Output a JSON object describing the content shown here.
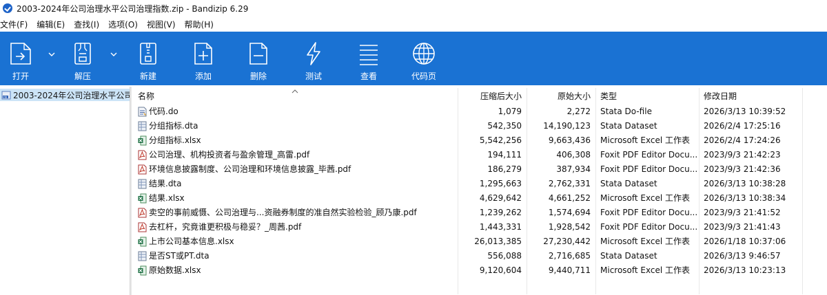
{
  "window": {
    "title": "2003-2024年公司治理水平公司治理指数.zip - Bandizip 6.29"
  },
  "menu": [
    "文件(F)",
    "编辑(E)",
    "查找(I)",
    "选项(O)",
    "视图(V)",
    "帮助(H)"
  ],
  "toolbar": {
    "open": "打开",
    "extract": "解压",
    "new": "新建",
    "add": "添加",
    "delete": "删除",
    "test": "测试",
    "view": "查看",
    "codepage": "代码页"
  },
  "tree": {
    "root": "2003-2024年公司治理水平公司"
  },
  "columns": {
    "name": "名称",
    "compressed": "压缩后大小",
    "original": "原始大小",
    "type": "类型",
    "modified": "修改日期"
  },
  "files": [
    {
      "name": "代码.do",
      "compressed": "1,079",
      "original": "2,272",
      "type": "Stata Do-file",
      "modified": "2026/3/13 10:39:52",
      "icon": "stata-do-icon"
    },
    {
      "name": "分组指标.dta",
      "compressed": "542,350",
      "original": "14,190,123",
      "type": "Stata Dataset",
      "modified": "2026/2/4 17:25:16",
      "icon": "stata-dta-icon"
    },
    {
      "name": "分组指标.xlsx",
      "compressed": "5,542,256",
      "original": "9,663,436",
      "type": "Microsoft Excel 工作表",
      "modified": "2026/2/4 17:24:26",
      "icon": "excel-icon"
    },
    {
      "name": "公司治理、机构投资者与盈余管理_高雷.pdf",
      "compressed": "194,111",
      "original": "406,308",
      "type": "Foxit PDF Editor Docu...",
      "modified": "2023/9/3 21:42:23",
      "icon": "pdf-icon"
    },
    {
      "name": "环境信息披露制度、公司治理和环境信息披露_毕茜.pdf",
      "compressed": "186,279",
      "original": "387,934",
      "type": "Foxit PDF Editor Docu...",
      "modified": "2023/9/3 21:42:36",
      "icon": "pdf-icon"
    },
    {
      "name": "结果.dta",
      "compressed": "1,295,663",
      "original": "2,762,331",
      "type": "Stata Dataset",
      "modified": "2026/3/13 10:38:28",
      "icon": "stata-dta-icon"
    },
    {
      "name": "结果.xlsx",
      "compressed": "4,629,642",
      "original": "4,661,252",
      "type": "Microsoft Excel 工作表",
      "modified": "2026/3/13 10:38:34",
      "icon": "excel-icon"
    },
    {
      "name": "卖空的事前威慑、公司治理与...资融券制度的准自然实验检验_顾乃康.pdf",
      "compressed": "1,239,262",
      "original": "1,574,694",
      "type": "Foxit PDF Editor Docu...",
      "modified": "2023/9/3 21:41:52",
      "icon": "pdf-icon"
    },
    {
      "name": "去杠杆，究竟谁更积极与稳妥？_周茜.pdf",
      "compressed": "1,443,331",
      "original": "1,928,542",
      "type": "Foxit PDF Editor Docu...",
      "modified": "2023/9/3 21:41:43",
      "icon": "pdf-icon"
    },
    {
      "name": "上市公司基本信息.xlsx",
      "compressed": "26,013,385",
      "original": "27,230,442",
      "type": "Microsoft Excel 工作表",
      "modified": "2026/1/18 10:37:06",
      "icon": "excel-icon"
    },
    {
      "name": "是否ST或PT.dta",
      "compressed": "556,088",
      "original": "2,716,685",
      "type": "Stata Dataset",
      "modified": "2026/3/13 9:46:57",
      "icon": "stata-dta-icon"
    },
    {
      "name": "原始数据.xlsx",
      "compressed": "9,120,604",
      "original": "9,440,711",
      "type": "Microsoft Excel 工作表",
      "modified": "2026/3/13 10:23:13",
      "icon": "excel-icon"
    }
  ],
  "colors": {
    "toolbar_bg": "#1a72d3",
    "tree_selection": "#cce4f7",
    "app_icon": "#1e63c8"
  }
}
